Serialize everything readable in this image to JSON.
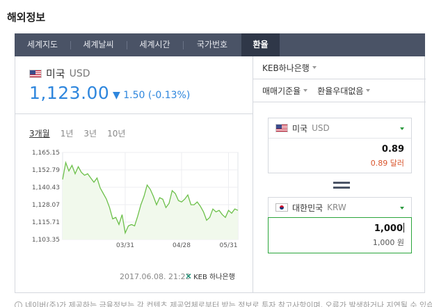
{
  "section_title": "해외정보",
  "tabs": [
    {
      "label": "세계지도"
    },
    {
      "label": "세계날씨"
    },
    {
      "label": "세계시간"
    },
    {
      "label": "국가번호"
    },
    {
      "label": "환율",
      "active": true
    }
  ],
  "currency": {
    "name": "미국",
    "code": "USD",
    "rate": "1,123.00",
    "change_arrow": "▼",
    "change": "1.50 (-0.13%)"
  },
  "periods": [
    "3개월",
    "1년",
    "3년",
    "10년"
  ],
  "timestamp": "2017.06.08. 21:23",
  "bank_logo_text": "KEB 하나은행",
  "right": {
    "bank": "KEB하나은행",
    "rate_type": "매매기준율",
    "preferential": "환율우대없음"
  },
  "converter": {
    "from": {
      "name": "미국",
      "code": "USD",
      "value": "0.89",
      "sub": "0.89 달러"
    },
    "to": {
      "name": "대한민국",
      "code": "KRW",
      "value": "1,000",
      "sub": "1,000 원"
    }
  },
  "notice": "네이버(주)가 제공하는 금융정보는 각 컨텐츠 제공업체로부터 받는 정보로 투자 참고사항이며, 오류가 발생하거나 지연될 수 있습",
  "colors": {
    "accent": "#2e86dd",
    "line": "#6cc04a",
    "tabbar": "#4a5366"
  },
  "chart_data": {
    "type": "area",
    "y_ticks": [
      "1,165.15",
      "1,152.79",
      "1,140.43",
      "1,128.07",
      "1,115.71",
      "1,103.35"
    ],
    "x_ticks": [
      "03/31",
      "04/28",
      "05/31"
    ],
    "ylim": [
      1103.35,
      1165.15
    ],
    "values": [
      1146,
      1158,
      1152,
      1156,
      1150,
      1155,
      1151,
      1149,
      1150,
      1147,
      1144,
      1147,
      1140,
      1136,
      1132,
      1126,
      1118,
      1119,
      1114,
      1121,
      1108,
      1113,
      1114,
      1113,
      1120,
      1128,
      1134,
      1142,
      1139,
      1134,
      1128,
      1133,
      1132,
      1126,
      1129,
      1138,
      1136,
      1131,
      1130,
      1132,
      1135,
      1128,
      1128,
      1130,
      1127,
      1123,
      1117,
      1119,
      1125,
      1123,
      1124,
      1121,
      1119,
      1124,
      1122,
      1125,
      1124
    ]
  }
}
